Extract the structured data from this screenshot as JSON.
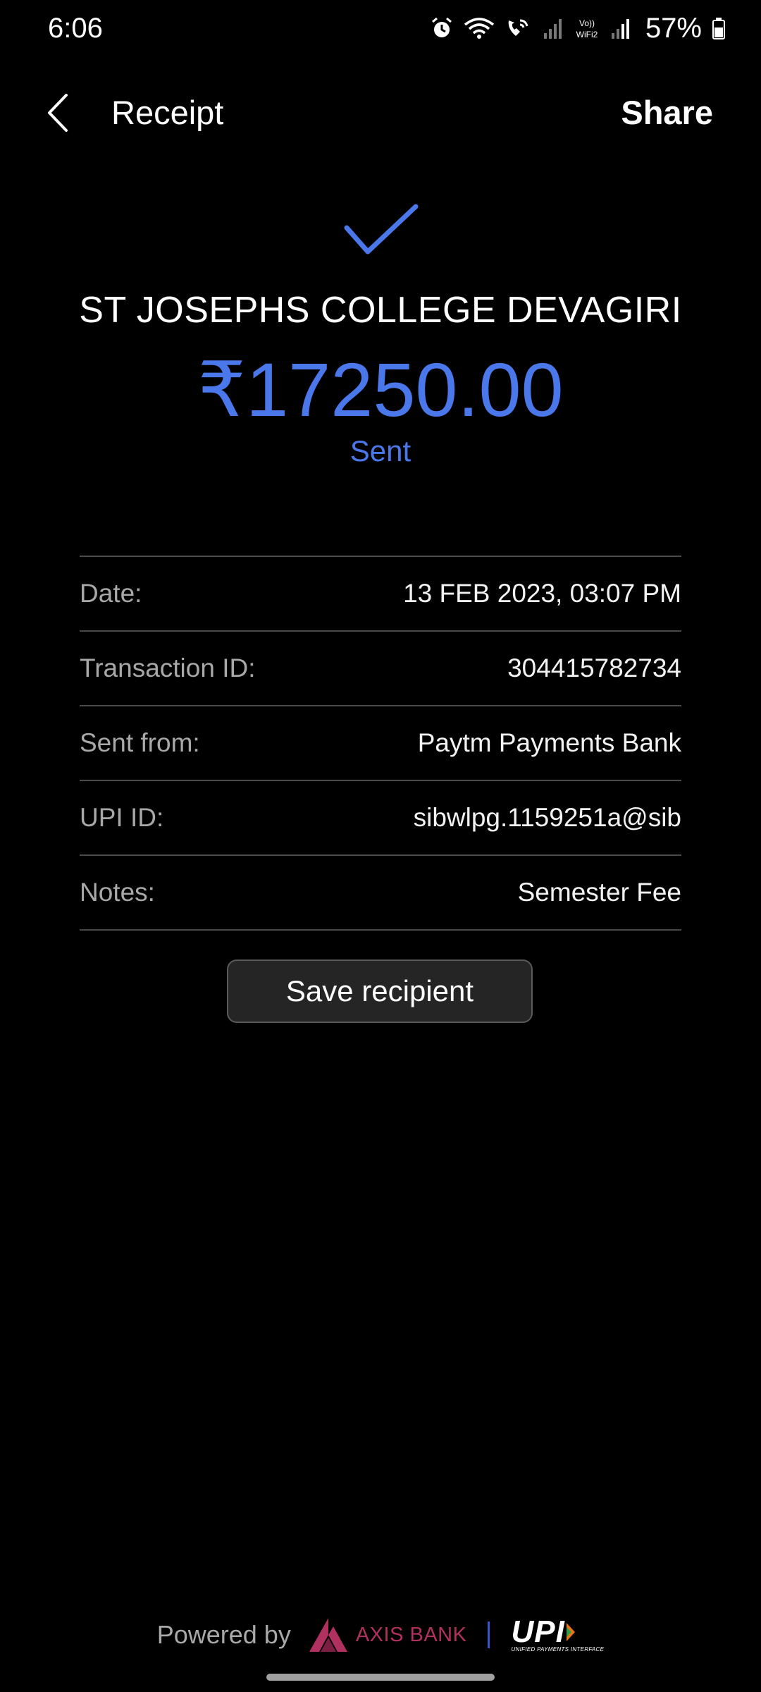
{
  "status_bar": {
    "time": "6:06",
    "wifi_label": "Vo)) WiFi2",
    "battery": "57%",
    "icons": [
      "alarm-icon",
      "wifi-icon",
      "wifi-call-icon",
      "signal-icon",
      "signal-icon"
    ]
  },
  "header": {
    "title": "Receipt",
    "share_label": "Share"
  },
  "summary": {
    "recipient": "ST JOSEPHS COLLEGE DEVAGIRI",
    "amount": "₹17250.00",
    "status": "Sent",
    "accent_color": "#4a78ea"
  },
  "details": [
    {
      "label": "Date:",
      "value": "13 FEB 2023, 03:07 PM"
    },
    {
      "label": "Transaction ID:",
      "value": "304415782734"
    },
    {
      "label": "Sent from:",
      "value": "Paytm Payments Bank"
    },
    {
      "label": "UPI ID:",
      "value": "sibwlpg.1159251a@sib"
    },
    {
      "label": "Notes:",
      "value": "Semester Fee"
    }
  ],
  "save_button_label": "Save recipient",
  "footer": {
    "powered_by": "Powered by",
    "bank_name": "AXIS BANK",
    "upi_label": "UPI",
    "upi_tagline": "UNIFIED PAYMENTS INTERFACE"
  }
}
